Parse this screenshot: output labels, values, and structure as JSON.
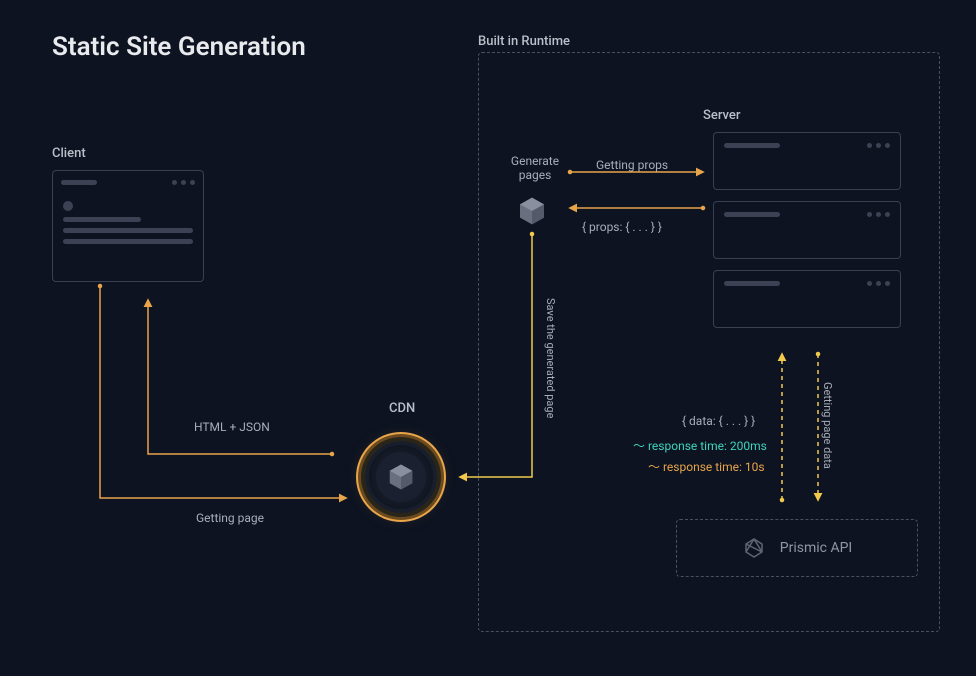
{
  "title": "Static Site Generation",
  "client": {
    "label": "Client"
  },
  "runtime": {
    "label": "Built in Runtime"
  },
  "server": {
    "label": "Server"
  },
  "cdn": {
    "label": "CDN"
  },
  "generate": {
    "label": "Generate pages"
  },
  "arrows": {
    "getting_props": "Getting props",
    "props_return": "{ props: { . . . } }",
    "save_page": "Save the generated page",
    "html_json": "HTML + JSON",
    "getting_page": "Getting page",
    "getting_page_data": "Getting page data",
    "data_return": "{ data: { . . . } }"
  },
  "metrics": {
    "response_200ms": "～ response time: 200ms",
    "response_10s": "～ response time: 10s"
  },
  "prismic": {
    "label": "Prismic API"
  }
}
